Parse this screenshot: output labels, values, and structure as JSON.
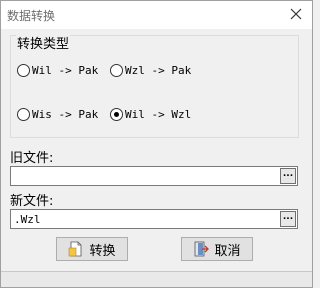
{
  "window": {
    "title": "数据转换",
    "close_icon": "close-icon"
  },
  "group": {
    "title": "转换类型",
    "options": [
      {
        "label": "Wil -> Pak",
        "checked": false
      },
      {
        "label": "Wzl -> Pak",
        "checked": false
      },
      {
        "label": "Wis -> Pak",
        "checked": false
      },
      {
        "label": "Wil -> Wzl",
        "checked": true
      }
    ]
  },
  "old_file": {
    "label": "旧文件:",
    "value": "",
    "browse_label": "..."
  },
  "new_file": {
    "label": "新文件:",
    "value": ".Wzl",
    "browse_label": "..."
  },
  "buttons": {
    "convert_label": "转换",
    "convert_icon": "document-convert-icon",
    "cancel_label": "取消",
    "cancel_icon": "exit-door-icon"
  }
}
